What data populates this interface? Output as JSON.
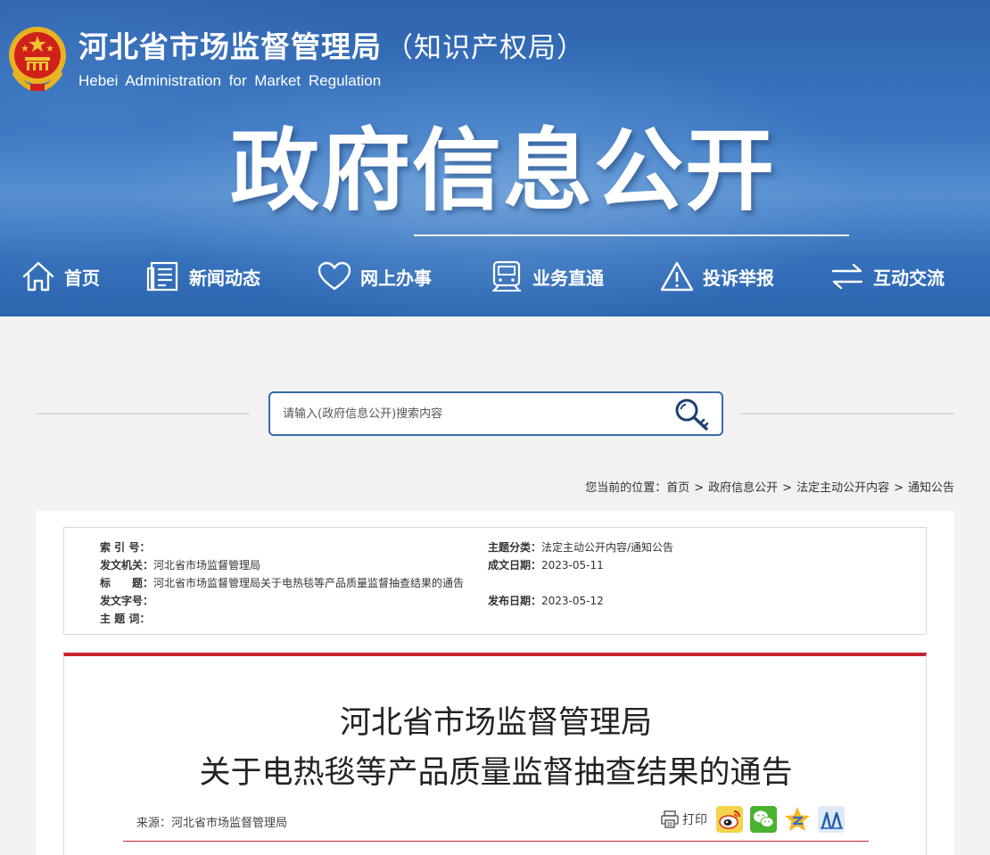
{
  "header": {
    "site_title": "河北省市场监督管理局",
    "site_title_sub": "（知识产权局）",
    "site_title_en": "Hebei Administration for Market Regulation",
    "section_title": "政府信息公开"
  },
  "nav": [
    {
      "label": "首页",
      "icon": "home-icon"
    },
    {
      "label": "新闻动态",
      "icon": "document-list-icon"
    },
    {
      "label": "网上办事",
      "icon": "heart-icon"
    },
    {
      "label": "业务直通",
      "icon": "train-icon"
    },
    {
      "label": "投诉举报",
      "icon": "warning-icon"
    },
    {
      "label": "互动交流",
      "icon": "exchange-arrows-icon"
    }
  ],
  "search": {
    "placeholder": "请输入(政府信息公开)搜索内容",
    "icon": "search-key-icon"
  },
  "breadcrumb": {
    "prefix": "您当前的位置：",
    "items": [
      "首页",
      "政府信息公开",
      "法定主动公开内容",
      "通知公告"
    ],
    "separator": ">"
  },
  "meta": {
    "index_no_label": "索 引 号：",
    "index_no": "",
    "issuer_label": "发文机关：",
    "issuer": "河北省市场监督管理局",
    "title_label": "标　　题：",
    "title": "河北省市场监督管理局关于电热毯等产品质量监督抽查结果的通告",
    "doc_no_label": "发文字号：",
    "doc_no": "",
    "keywords_label": "主 题 词：",
    "keywords": "",
    "category_label": "主题分类：",
    "category": "法定主动公开内容/通知公告",
    "created_label": "成文日期：",
    "created": "2023-05-11",
    "published_label": "发布日期：",
    "published": "2023-05-12"
  },
  "article": {
    "title_line1": "河北省市场监督管理局",
    "title_line2": "关于电热毯等产品质量监督抽查结果的通告",
    "source_label": "来源：",
    "source": "河北省市场监督管理局",
    "print_label": "打印",
    "share_icons": [
      "weibo-icon",
      "wechat-icon",
      "qzone-icon",
      "renren-icon"
    ]
  },
  "colors": {
    "header_blue": "#3a74bf",
    "accent_red": "#c8242c",
    "search_border": "#3a6aa8"
  }
}
